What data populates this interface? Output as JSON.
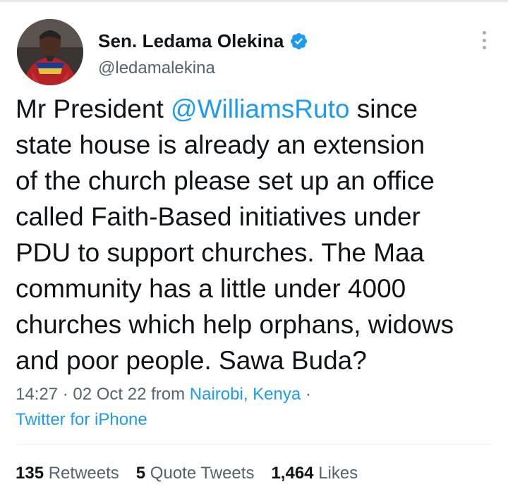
{
  "author": {
    "display_name": "Sen. Ledama Olekina",
    "handle": "@ledamalekina",
    "verified": true,
    "avatar_icon": "profile-photo",
    "verified_icon": "verified-badge-icon",
    "more_icon": "more-options-icon"
  },
  "tweet": {
    "text_before": "Mr President ",
    "mention": "@WilliamsRuto",
    "text_after": " since\nstate house is already an extension\nof the church please set up an office\ncalled Faith-Based initiatives under\nPDU to support churches. The Maa\ncommunity has a little under 4000\nchurches which help orphans, widows\nand poor people.  Sawa Buda?"
  },
  "meta": {
    "time": "14:27",
    "sep1": " · ",
    "date": "02 Oct 22",
    "from_label": " from ",
    "location": "Nairobi, Kenya",
    "sep2": " ·",
    "source": "Twitter for iPhone"
  },
  "stats": {
    "retweets_count": "135",
    "retweets_label": "Retweets",
    "quotes_count": "5",
    "quotes_label": "Quote Tweets",
    "likes_count": "1,464",
    "likes_label": "Likes"
  },
  "colors": {
    "accent": "#1d9bf0",
    "text_primary": "#0f1419",
    "text_secondary": "#536471",
    "border": "#eff3f4"
  }
}
